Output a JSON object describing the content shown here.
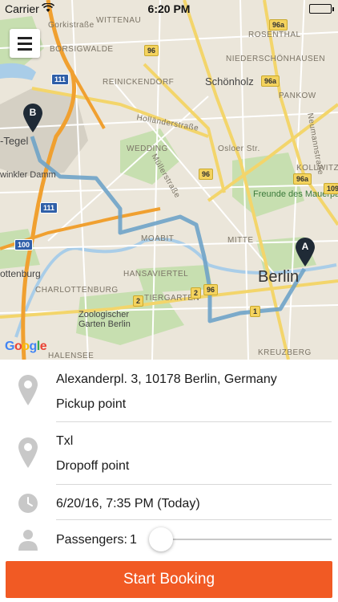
{
  "status_bar": {
    "carrier": "Carrier",
    "time": "6:20 PM"
  },
  "map": {
    "labels": {
      "gorkistrasse": "Gorkistraße",
      "wittenau": "WITTENAU",
      "niedschonhausen": "NIEDERSCHÖNHAUSEN",
      "rosenthal": "ROSENTHAL",
      "borsigwalde": "BORSIGWALDE",
      "reinickendorf": "REINICKENDORF",
      "schonholz": "Schönholz",
      "pankow": "PANKOW",
      "neumannstrasse": "Neumannstraße",
      "hollanderstrasse": "Holländerstraße",
      "tegel": "-Tegel",
      "wedding": "WEDDING",
      "oslauer": "Osloer Str.",
      "prenzlkiez": "KOLLWITZKIEZ",
      "mullerstrasse": "Müllerstraße",
      "winkler": "winkler Damm",
      "freunde": "Freunde des Mauerparks eV",
      "moabit": "MOABIT",
      "mitte": "MITTE",
      "ottenburg": "ottenburg",
      "charlottenburg": "CHARLOTTENBURG",
      "hansaviertel": "HANSAVIERTEL",
      "tiergarten": "TIERGARTEN",
      "berlin": "Berlin",
      "zoo": "Zoologischer Garten Berlin",
      "halensee": "HALENSEE",
      "kreuzberg": "KREUZBERG",
      "google": "Google"
    },
    "shields": {
      "s96a_top": "96a",
      "s96_top": "96",
      "s111a": "111",
      "s111b": "111",
      "s96a_mid": "96a",
      "s96a_right": "96a",
      "s96_mid": "96",
      "s109": "109",
      "s100": "100",
      "s2a": "2",
      "s2b": "2",
      "s96_low": "96",
      "s1": "1"
    },
    "markers": {
      "a": "A",
      "b": "B"
    }
  },
  "booking": {
    "pickup_address": "Alexanderpl. 3, 10178 Berlin, Germany",
    "pickup_label": "Pickup point",
    "dropoff_address": "Txl",
    "dropoff_label": "Dropoff point",
    "datetime": "6/20/16, 7:35 PM (Today)",
    "passengers_label": "Passengers:",
    "passengers_count": "1",
    "start_button": "Start Booking"
  },
  "colors": {
    "accent": "#f15a24",
    "route": "#6fa3c8"
  }
}
